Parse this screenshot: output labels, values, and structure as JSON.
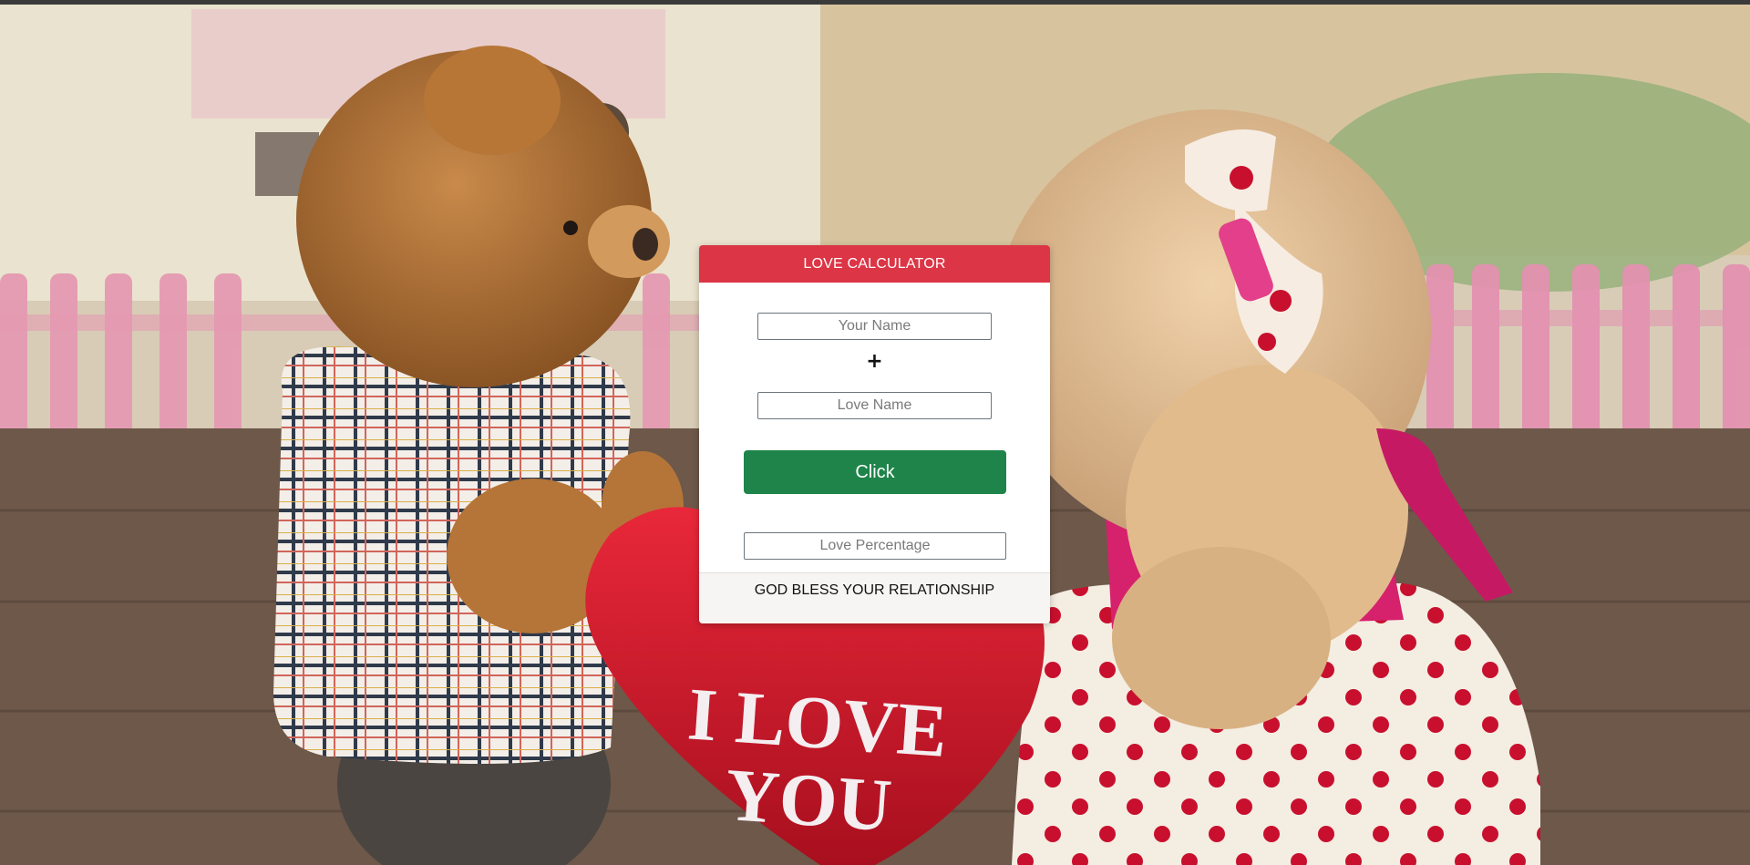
{
  "background": {
    "image_icon": "teddy-bears-photo",
    "heart_text_line1": "I LOVE",
    "heart_text_line2": "YOU"
  },
  "card": {
    "title": "LOVE CALCULATOR",
    "your_name_placeholder": "Your Name",
    "plus_symbol": "+",
    "love_name_placeholder": "Love Name",
    "button_label": "Click",
    "percentage_placeholder": "Love Percentage",
    "footer_text": "GOD BLESS YOUR RELATIONSHIP"
  },
  "colors": {
    "header": "#dc3545",
    "button": "#1e8449",
    "footer_bg": "#f7f5f3"
  }
}
